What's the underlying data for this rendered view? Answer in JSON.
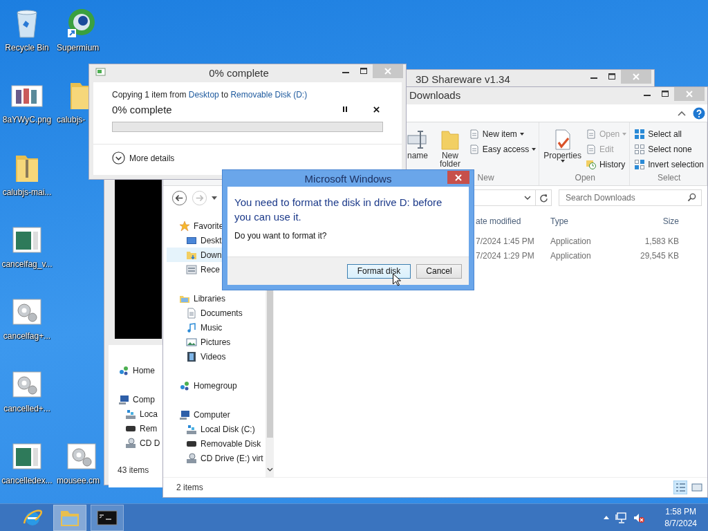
{
  "desktop_icons": [
    {
      "label": "Recycle Bin",
      "kind": "recycle"
    },
    {
      "label": "Supermium",
      "kind": "browser"
    },
    {
      "label": "8aYWyC.png",
      "kind": "image"
    },
    {
      "label": "calubjs-",
      "kind": "folder"
    },
    {
      "label": "calubjs-mai...",
      "kind": "zip"
    },
    {
      "label": "cancelfag_v...",
      "kind": "window"
    },
    {
      "label": "cancelfag+...",
      "kind": "gear"
    },
    {
      "label": "cancelled+...",
      "kind": "gear"
    },
    {
      "label": "cancelledex...",
      "kind": "window"
    },
    {
      "label": "mousee.cm",
      "kind": "gear"
    }
  ],
  "back_window": {
    "nav": [
      {
        "label": "Home",
        "kind": "homegroup",
        "selected": false
      },
      {
        "label": "Comp",
        "kind": "computer",
        "selected": false,
        "children": [
          {
            "label": "Loca",
            "kind": "disk",
            "selected": false
          },
          {
            "label": "Rem",
            "kind": "removable",
            "selected": false
          },
          {
            "label": "CD D",
            "kind": "cd",
            "selected": false
          }
        ]
      }
    ],
    "status": "43 items"
  },
  "shareware_window": {
    "title": "3D Shareware v1.34"
  },
  "explorer": {
    "title": "Downloads",
    "ribbon": {
      "partial_label": "name",
      "groups": [
        {
          "label": "New",
          "big": {
            "label": "New folder",
            "kind": "folder",
            "dropdown": false
          },
          "items": [
            {
              "label": "New item",
              "kind": "new-item",
              "dropdown": true,
              "disabled": false
            },
            {
              "label": "Easy access",
              "kind": "easy-access",
              "dropdown": true,
              "disabled": false
            }
          ]
        },
        {
          "label": "Open",
          "big": {
            "label": "Properties",
            "kind": "properties",
            "dropdown": true
          },
          "items": [
            {
              "label": "Open",
              "kind": "open",
              "dropdown": true,
              "disabled": true
            },
            {
              "label": "Edit",
              "kind": "edit",
              "dropdown": false,
              "disabled": true
            },
            {
              "label": "History",
              "kind": "history",
              "dropdown": false,
              "disabled": false
            }
          ]
        },
        {
          "label": "Select",
          "items": [
            {
              "label": "Select all",
              "kind": "select-all",
              "dropdown": false,
              "disabled": false
            },
            {
              "label": "Select none",
              "kind": "select-none",
              "dropdown": false,
              "disabled": false
            },
            {
              "label": "Invert selection",
              "kind": "invert",
              "dropdown": false,
              "disabled": false
            }
          ]
        }
      ]
    },
    "search": {
      "placeholder": "Search Downloads"
    },
    "nav": [
      {
        "label": "Favorite",
        "kind": "star",
        "selected": false,
        "children": [
          {
            "label": "Deskt",
            "kind": "desktop",
            "selected": false
          },
          {
            "label": "Down",
            "kind": "downloads",
            "selected": true
          },
          {
            "label": "Rece",
            "kind": "recent",
            "selected": false
          }
        ]
      },
      {
        "label": "Libraries",
        "kind": "library",
        "selected": false,
        "children": [
          {
            "label": "Documents",
            "kind": "document",
            "selected": false
          },
          {
            "label": "Music",
            "kind": "music",
            "selected": false
          },
          {
            "label": "Pictures",
            "kind": "pictures",
            "selected": false
          },
          {
            "label": "Videos",
            "kind": "videos",
            "selected": false
          }
        ]
      },
      {
        "label": "Homegroup",
        "kind": "homegroup",
        "selected": false
      },
      {
        "label": "Computer",
        "kind": "computer",
        "selected": false,
        "children": [
          {
            "label": "Local Disk (C:)",
            "kind": "disk",
            "selected": false
          },
          {
            "label": "Removable Disk",
            "kind": "removable",
            "selected": false
          },
          {
            "label": "CD Drive (E:) virt",
            "kind": "cd",
            "selected": false
          }
        ]
      }
    ],
    "columns": [
      "ate modified",
      "Type",
      "Size"
    ],
    "rows": [
      {
        "cells": [
          "7/2024 1:45 PM",
          "Application",
          "1,583 KB"
        ]
      },
      {
        "cells": [
          "7/2024 1:29 PM",
          "Application",
          "29,545 KB"
        ]
      }
    ],
    "status": "2 items",
    "view_buttons": [
      {
        "kind": "details",
        "selected": true
      },
      {
        "kind": "large-icons",
        "selected": false
      }
    ]
  },
  "copy_dialog": {
    "title": "0% complete",
    "lead": "Copying 1 item from",
    "source": "Desktop",
    "joiner": "to",
    "destination": "Removable Disk (D:)",
    "progress_text": "0% complete",
    "level": 0,
    "more": "More details"
  },
  "message_box": {
    "title": "Microsoft Windows",
    "instruction": "You need to format the disk in drive D: before you can use it.",
    "question": "Do you want to format it?",
    "buttons": [
      {
        "label": "Format disk",
        "selected": true
      },
      {
        "label": "Cancel",
        "selected": false
      }
    ]
  },
  "taskbar": {
    "apps": [
      {
        "kind": "browser",
        "running": false,
        "selected": false
      },
      {
        "kind": "folder",
        "running": true,
        "selected": true
      },
      {
        "kind": "console",
        "running": true,
        "selected": false
      }
    ],
    "time": "1:58 PM",
    "date": "8/7/2024"
  }
}
